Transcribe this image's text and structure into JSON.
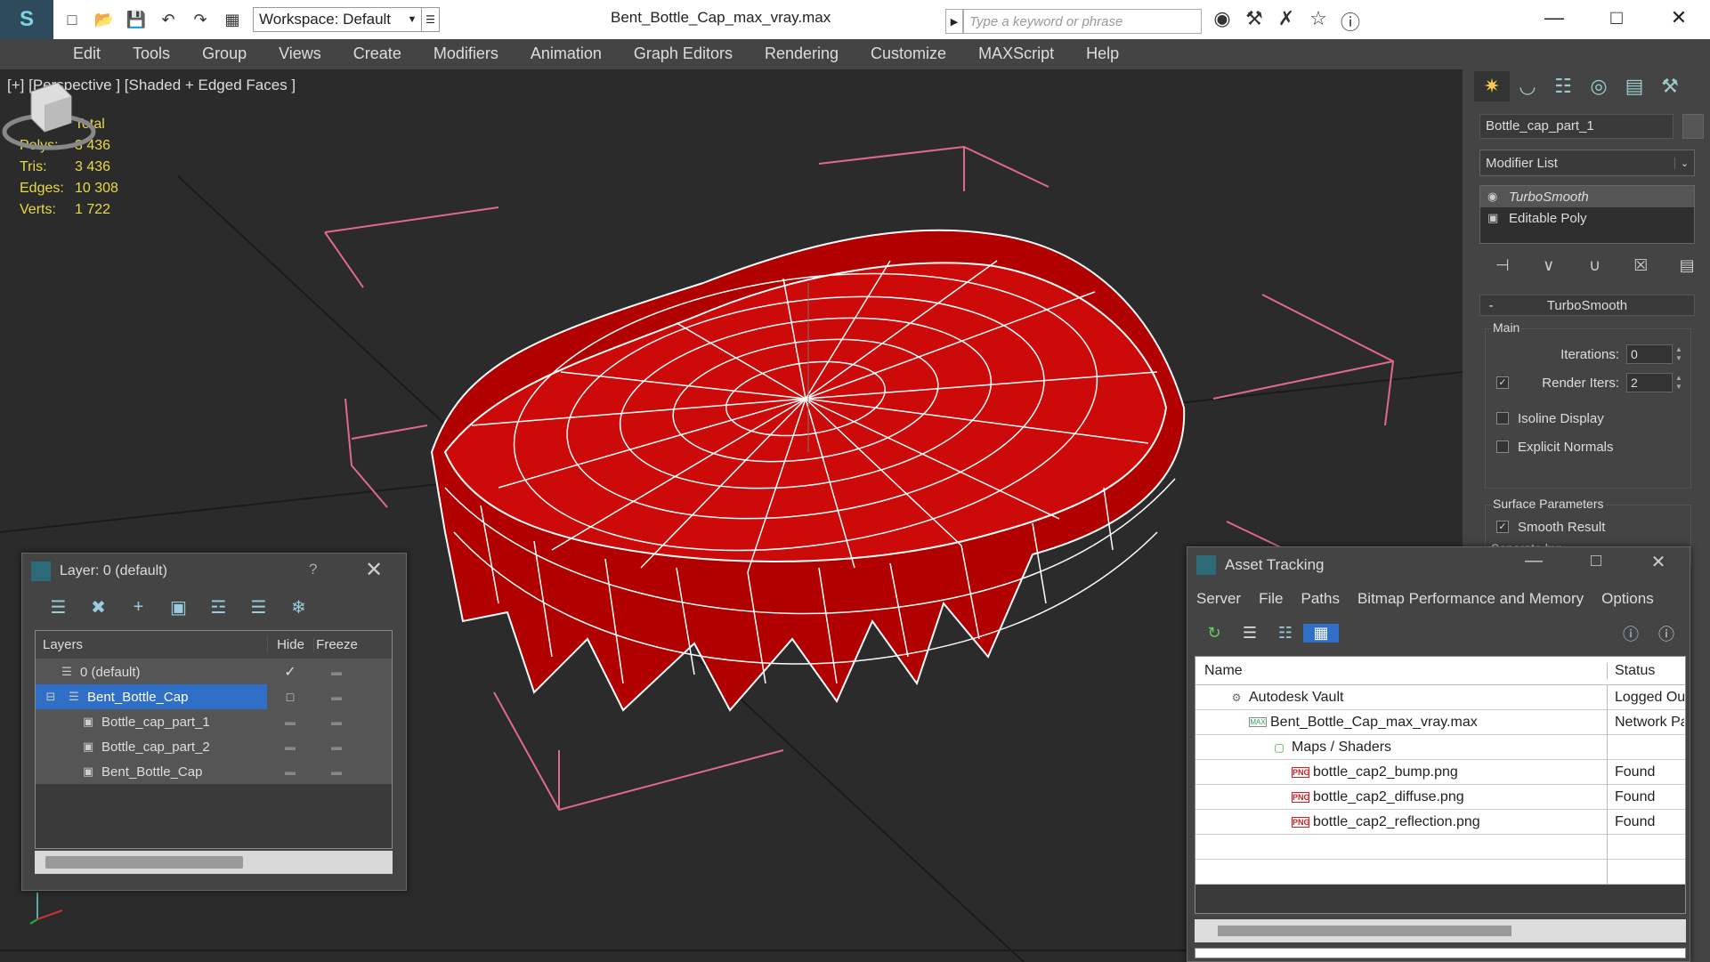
{
  "app": {
    "file_title": "Bent_Bottle_Cap_max_vray.max",
    "workspace": "Workspace: Default",
    "search_placeholder": "Type a keyword or phrase"
  },
  "menu": [
    "Edit",
    "Tools",
    "Group",
    "Views",
    "Create",
    "Modifiers",
    "Animation",
    "Graph Editors",
    "Rendering",
    "Customize",
    "MAXScript",
    "Help"
  ],
  "viewport": {
    "label": "[+] [Perspective ] [Shaded + Edged Faces ]",
    "stats_header": "Total",
    "stats": [
      {
        "k": "Polys:",
        "v": "3 436"
      },
      {
        "k": "Tris:",
        "v": "3 436"
      },
      {
        "k": "Edges:",
        "v": "10 308"
      },
      {
        "k": "Verts:",
        "v": "1 722"
      }
    ],
    "object_color": "#c40000",
    "wire_color": "#ffffff",
    "bbox_color": "#e06a8a"
  },
  "command_panel": {
    "object_name": "Bottle_cap_part_1",
    "modifier_list": "Modifier List",
    "stack": [
      "TurboSmooth",
      "Editable Poly"
    ],
    "rollout_title": "TurboSmooth",
    "main_group": "Main",
    "iterations_label": "Iterations:",
    "iterations_value": "0",
    "render_iters_label": "Render Iters:",
    "render_iters_value": "2",
    "isoline": "Isoline Display",
    "explicit_normals": "Explicit Normals",
    "surface_group": "Surface Parameters",
    "smooth_result": "Smooth Result",
    "separate_by": "Separate by:"
  },
  "layer_window": {
    "title": "Layer: 0 (default)",
    "help": "?",
    "columns": [
      "Layers",
      "Hide",
      "Freeze"
    ],
    "rows": [
      {
        "name": "0 (default)",
        "indent": 1
      },
      {
        "name": "Bent_Bottle_Cap",
        "indent": 1
      },
      {
        "name": "Bottle_cap_part_1",
        "indent": 2
      },
      {
        "name": "Bottle_cap_part_2",
        "indent": 2
      },
      {
        "name": "Bent_Bottle_Cap",
        "indent": 2
      }
    ]
  },
  "asset_window": {
    "title": "Asset Tracking",
    "menu": [
      "Server",
      "File",
      "Paths",
      "Bitmap Performance and Memory",
      "Options"
    ],
    "columns": [
      "Name",
      "Status"
    ],
    "rows": [
      {
        "name": "Autodesk Vault",
        "status": "Logged Ou"
      },
      {
        "name": "Bent_Bottle_Cap_max_vray.max",
        "status": "Network Pa"
      },
      {
        "name": "Maps / Shaders",
        "status": ""
      },
      {
        "name": "bottle_cap2_bump.png",
        "status": "Found"
      },
      {
        "name": "bottle_cap2_diffuse.png",
        "status": "Found"
      },
      {
        "name": "bottle_cap2_reflection.png",
        "status": "Found"
      }
    ],
    "png_badge": "PNG",
    "max_badge": "MAX"
  }
}
